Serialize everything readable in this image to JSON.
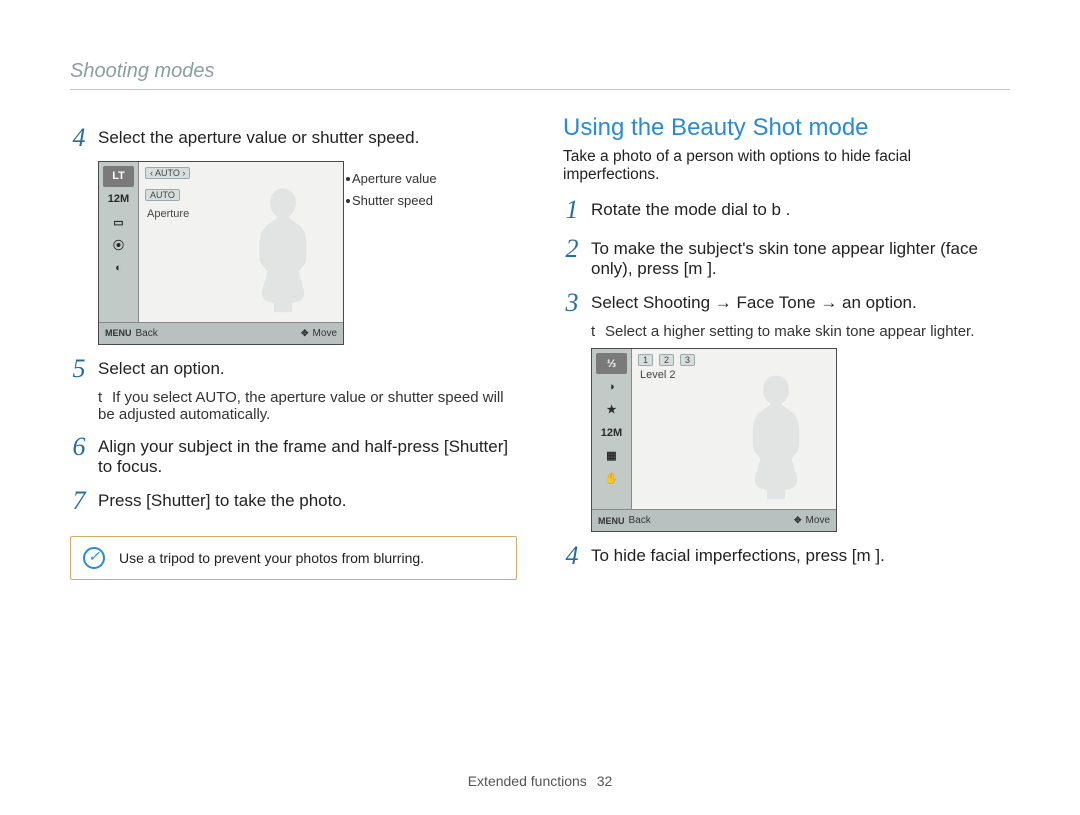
{
  "header": {
    "title": "Shooting modes"
  },
  "left": {
    "steps": [
      {
        "n": "4",
        "text": "Select the aperture value or shutter speed."
      },
      {
        "n": "5",
        "text": "Select an option."
      },
      {
        "n": "",
        "sub": "If you select AUTO, the aperture value or shutter speed will be adjusted automatically."
      },
      {
        "n": "6",
        "text": "Align your subject in the frame and half-press [Shutter] to focus."
      },
      {
        "n": "7",
        "text": "Press [Shutter] to take the photo."
      }
    ],
    "tip": "Use a tripod to prevent your photos from blurring.",
    "screen": {
      "sidebar_icons": [
        "LT",
        "12M",
        "▭",
        "⦿",
        "◐"
      ],
      "topbar_rows": [
        {
          "pill": "‹  AUTO  ›",
          "annot": "Aperture value"
        },
        {
          "pill": "AUTO",
          "annot": "Shutter speed"
        }
      ],
      "aperture_label": "Aperture",
      "footer": {
        "left_icon": "MENU",
        "left_text": "Back",
        "right_icon": "✥",
        "right_text": "Move"
      }
    }
  },
  "right": {
    "heading": "Using the Beauty Shot mode",
    "intro": "Take a photo of a person with options to hide facial imperfections.",
    "steps": [
      {
        "n": "1",
        "text": "Rotate the mode dial to b ."
      },
      {
        "n": "2",
        "text": "To make the subject's skin tone appear lighter (face only), press [m  ]."
      },
      {
        "n": "3",
        "text": "Select Shooting → Face Tone → an option."
      },
      {
        "n": "",
        "sub": "Select a higher setting to make skin tone appear lighter."
      },
      {
        "n": "4",
        "text": "To hide facial imperfections, press [m  ]."
      }
    ],
    "screen": {
      "sidebar_icons": [
        "⅓",
        "◑",
        "★",
        "12M",
        "▦",
        "✋"
      ],
      "top_icons": [
        "1",
        "2",
        "3"
      ],
      "level_label": "Level 2",
      "footer": {
        "left_icon": "MENU",
        "left_text": "Back",
        "right_icon": "✥",
        "right_text": "Move"
      }
    }
  },
  "footer": {
    "text": "Extended functions",
    "page": "32"
  }
}
